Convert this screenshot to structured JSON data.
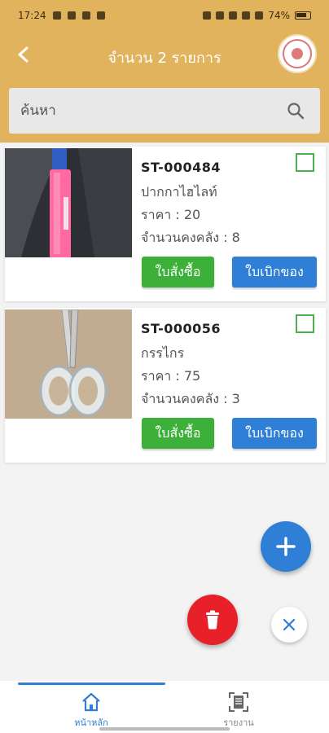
{
  "status_bar": {
    "time": "17:24",
    "battery": "74%"
  },
  "header": {
    "title": "จำนวน 2 รายการ"
  },
  "search": {
    "placeholder": "ค้นหา"
  },
  "items": [
    {
      "code": "ST-000484",
      "name": "ปากกาไฮไลท์",
      "price": "ราคา : 20",
      "stock": "จำนวนคงคลัง : 8",
      "checked": false
    },
    {
      "code": "ST-000056",
      "name": "กรรไกร",
      "price": "ราคา : 75",
      "stock": "จำนวนคงคลัง : 3",
      "checked": false
    }
  ],
  "buttons": {
    "purchase_order": "ใบสั่งซื้อ",
    "withdraw": "ใบเบิกของ"
  },
  "bottom_nav": {
    "home": "หน้าหลัก",
    "report": "รายงาน"
  },
  "colors": {
    "header": "#e2b35d",
    "primary_blue": "#2f7fd6",
    "green": "#3cb038",
    "red": "#e8202a"
  }
}
